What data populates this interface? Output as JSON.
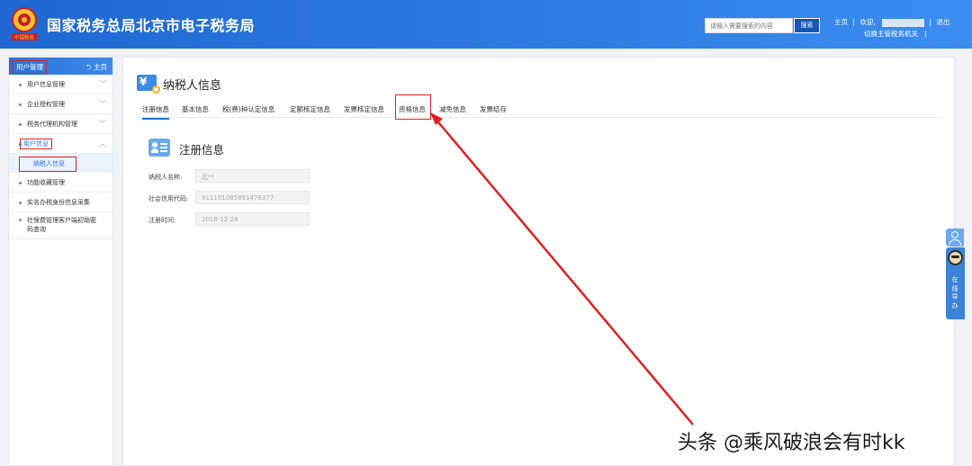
{
  "header": {
    "site_title": "国家税务总局北京市电子税务局",
    "emblem_text": "中国税务",
    "search_placeholder": "请输入需要搜索的内容",
    "search_button": "搜索",
    "home_link": "主页",
    "welcome": "欢迎,",
    "logout": "退出",
    "switch_agency": "切换主管税务机关"
  },
  "sidebar": {
    "title": "用户管理",
    "home": "主页",
    "items": [
      {
        "label": "用户信息管理",
        "chevron": "chevron-down"
      },
      {
        "label": "企业授权管理",
        "chevron": "chevron-down"
      },
      {
        "label": "税务代理机构管理",
        "chevron": "chevron-down"
      },
      {
        "label": "用户信息",
        "chevron": "chevron-up"
      },
      {
        "label": "纳税人信息"
      },
      {
        "label": "功能收藏管理"
      },
      {
        "label": "实名办税身份信息采集"
      },
      {
        "label": "社保费管理客户端初始密码查询"
      }
    ]
  },
  "main": {
    "page_title": "纳税人信息",
    "tabs": [
      "注册信息",
      "基本信息",
      "税(费)种认定信息",
      "定额核定信息",
      "发票核定信息",
      "资格信息",
      "减免信息",
      "发票结存"
    ],
    "active_tab": "注册信息",
    "section_title": "注册信息",
    "fields": [
      {
        "label": "纳税人名称:",
        "value": "北**"
      },
      {
        "label": "社会信用代码:",
        "value": "911101085891476377"
      },
      {
        "label": "注册时间:",
        "value": "2018-12-28"
      }
    ]
  },
  "float_widget": {
    "help_text": "在线导办"
  },
  "watermark": "头条 @乘风破浪会有时kk",
  "colors": {
    "header_blue": "#2a72d6",
    "annotation_red": "#e02020",
    "active_blue": "#2a72d6"
  }
}
